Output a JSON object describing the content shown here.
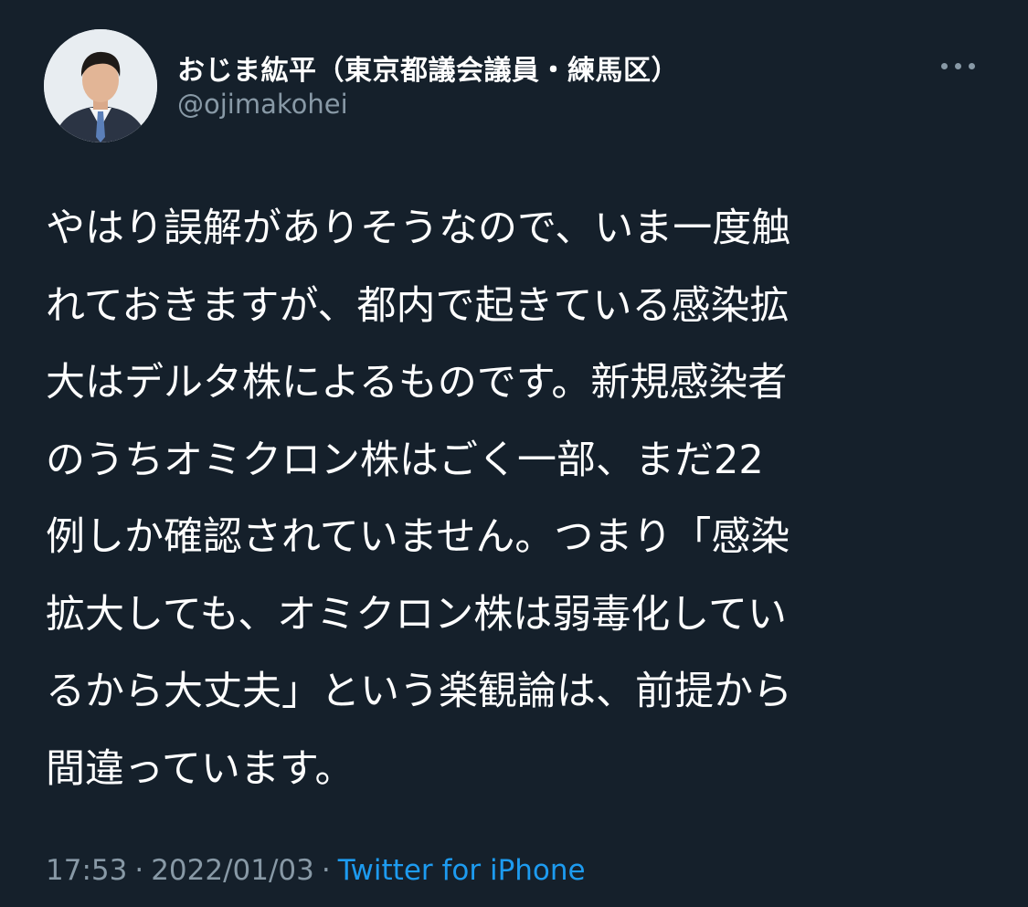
{
  "author": {
    "display_name": "おじま紘平（東京都議会議員・練馬区）",
    "handle": "@ojimakohei"
  },
  "more_icon": "more-horizontal-icon",
  "tweet": {
    "lines": [
      "やはり誤解がありそうなので、いま一度触",
      "れておきますが、都内で起きている感染拡",
      "大はデルタ株によるものです。新規感染者",
      "のうちオミクロン株はごく一部、まだ22",
      "例しか確認されていません。つまり「感染",
      "拡大しても、オミクロン株は弱毒化してい",
      "るから大丈夫」という楽観論は、前提から",
      "間違っています。"
    ]
  },
  "meta": {
    "time": "17:53",
    "separator": "·",
    "date": "2022/01/03",
    "source": "Twitter for iPhone"
  },
  "colors": {
    "background": "#15202b",
    "text_primary": "#ffffff",
    "text_secondary": "#8899a6",
    "link": "#1d9bf0"
  }
}
